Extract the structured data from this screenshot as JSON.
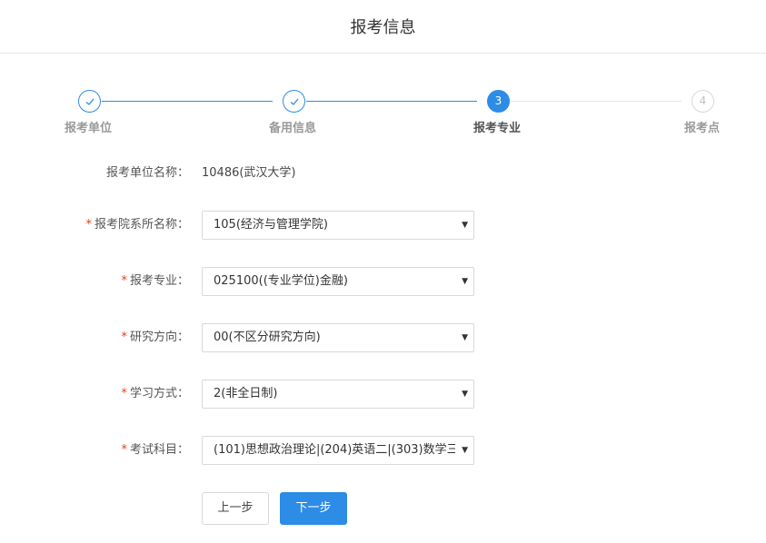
{
  "header": {
    "title": "报考信息"
  },
  "steps": [
    {
      "number": "1",
      "label": "报考单位",
      "state": "done"
    },
    {
      "number": "2",
      "label": "备用信息",
      "state": "done"
    },
    {
      "number": "3",
      "label": "报考专业",
      "state": "active"
    },
    {
      "number": "4",
      "label": "报考点",
      "state": "todo"
    }
  ],
  "form": {
    "unit": {
      "label": "报考单位名称：",
      "value": "10486(武汉大学)"
    },
    "department": {
      "required_mark": "*",
      "label": "报考院系所名称：",
      "value": "105(经济与管理学院)"
    },
    "major": {
      "required_mark": "*",
      "label": "报考专业：",
      "value": "025100((专业学位)金融)"
    },
    "direction": {
      "required_mark": "*",
      "label": "研究方向：",
      "value": "00(不区分研究方向)"
    },
    "study_mode": {
      "required_mark": "*",
      "label": "学习方式：",
      "value": "2(非全日制)"
    },
    "subjects": {
      "required_mark": "*",
      "label": "考试科目：",
      "value": "(101)思想政治理论|(204)英语二|(303)数学三"
    }
  },
  "buttons": {
    "prev_label": "上一步",
    "next_label": "下一步"
  },
  "colors": {
    "accent": "#2d8ce6",
    "required": "#e2401c",
    "inactive": "#d9d9d9"
  },
  "icons": {
    "done": "check-icon",
    "dropdown": "caret-down-icon"
  }
}
